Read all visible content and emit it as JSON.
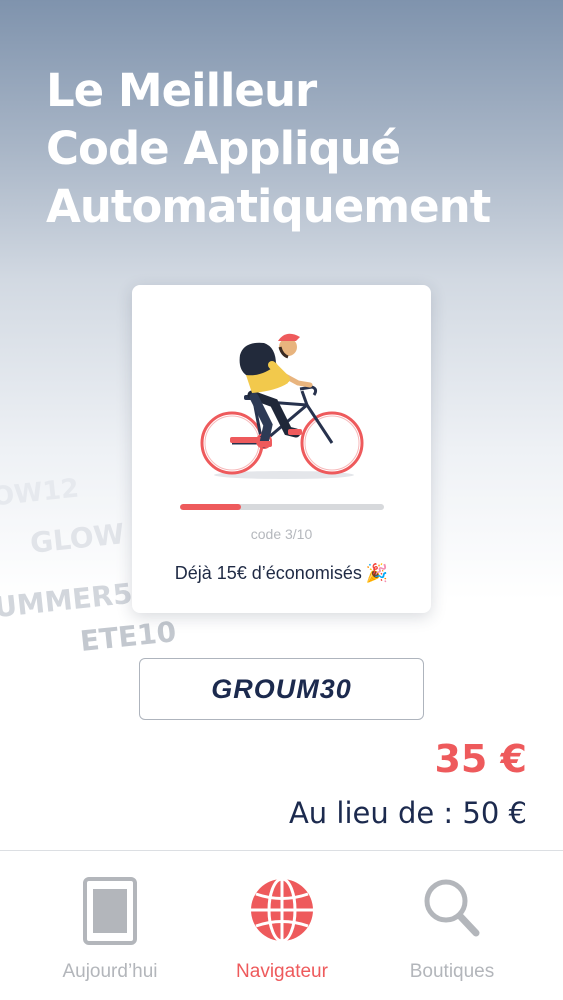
{
  "headline": {
    "line1": "Le Meilleur",
    "line2": "Code Appliqué",
    "line3": "Automatiquement"
  },
  "floating_codes": [
    "OW12",
    "GLOW",
    "UMMER5",
    "ETE10"
  ],
  "card": {
    "progress": 0.3,
    "code_count": "code 3/10",
    "savings_text": "Déjà 15€ d’économisés",
    "savings_emoji": "🎉"
  },
  "promo_code": "GROUM30",
  "price": "35 €",
  "old_price": "Au lieu de : 50 €",
  "tabs": [
    {
      "label": "Aujourd’hui",
      "icon": "newspaper-icon",
      "active": false
    },
    {
      "label": "Navigateur",
      "icon": "globe-icon",
      "active": true
    },
    {
      "label": "Boutiques",
      "icon": "search-icon",
      "active": false
    }
  ],
  "colors": {
    "accent": "#ee5a5c",
    "navy": "#1c2a4e",
    "inactive": "#b3b6bb"
  }
}
